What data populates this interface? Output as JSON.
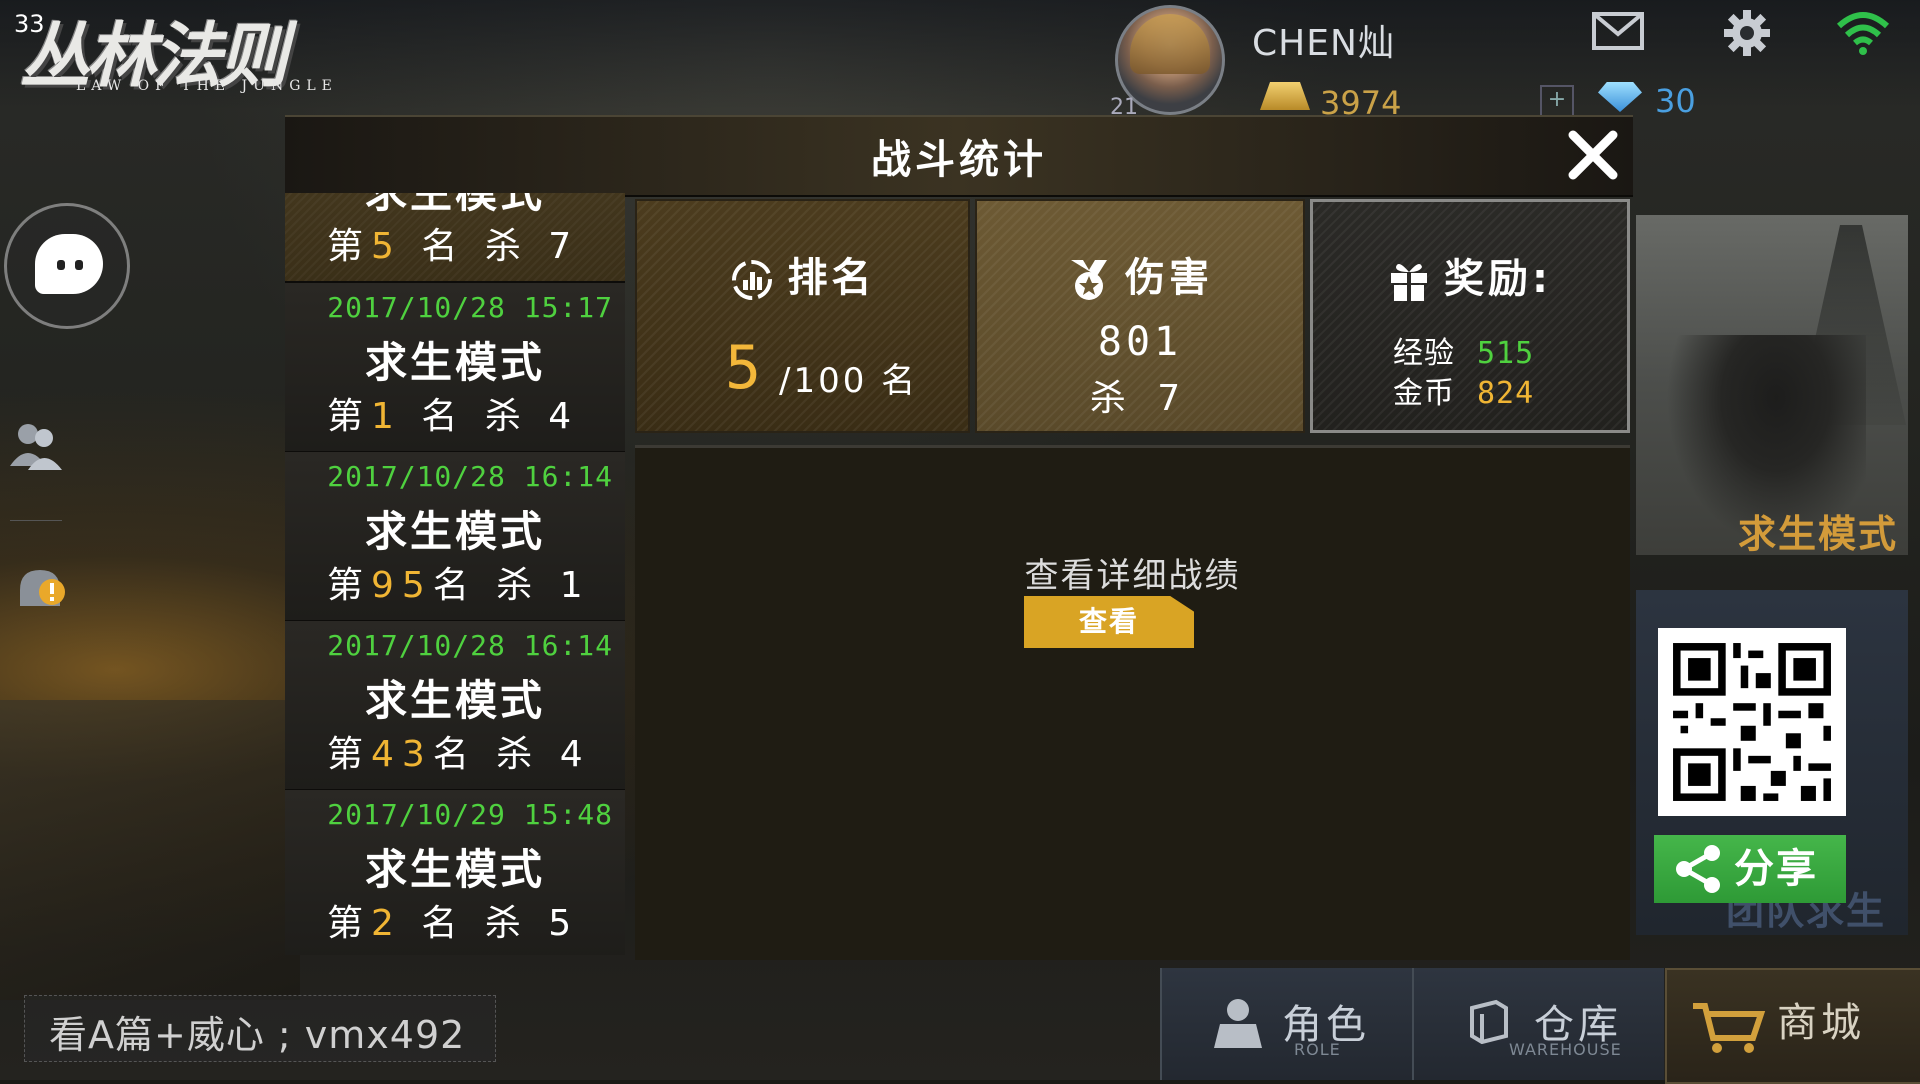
{
  "status": {
    "fps": "33"
  },
  "logo": {
    "title": "丛林法则",
    "subtitle": "LAW OF THE JUNGLE"
  },
  "profile": {
    "username": "CHEN灿",
    "level": "21",
    "gold": "3974",
    "diamonds": "30"
  },
  "dialog": {
    "title": "战斗统计",
    "close_icon": "close-icon",
    "history": [
      {
        "date": "",
        "mode": "求生模式",
        "rank_prefix": "第",
        "rank": "5",
        "rank_suffix": "名 杀",
        "kills": "7",
        "selected": true
      },
      {
        "date": "2017/10/28 15:17",
        "mode": "求生模式",
        "rank_prefix": "第",
        "rank": "1",
        "rank_suffix": "名 杀",
        "kills": "4"
      },
      {
        "date": "2017/10/28 16:14",
        "mode": "求生模式",
        "rank_prefix": "第",
        "rank": "95",
        "rank_suffix": "名 杀",
        "kills": "1"
      },
      {
        "date": "2017/10/28 16:14",
        "mode": "求生模式",
        "rank_prefix": "第",
        "rank": "43",
        "rank_suffix": "名 杀",
        "kills": "4"
      },
      {
        "date": "2017/10/29 15:48",
        "mode": "求生模式",
        "rank_prefix": "第",
        "rank": "2",
        "rank_suffix": "名 杀",
        "kills": "5"
      }
    ],
    "rank_card": {
      "title": "排名",
      "value": "5",
      "total": "/100 名"
    },
    "damage_card": {
      "title": "伤害",
      "value": "801",
      "kills_label": "杀",
      "kills": "7"
    },
    "reward_card": {
      "title": "奖励:",
      "exp_label": "经验",
      "exp": "515",
      "gold_label": "金币",
      "gold": "824"
    },
    "detail_label": "查看详细战绩",
    "view_button": "查看"
  },
  "right_panel": {
    "mode_label": "求生模式",
    "team_label": "团队求生",
    "share_button": "分享"
  },
  "bottom_nav": [
    {
      "label": "角色",
      "sub": "ROLE"
    },
    {
      "label": "仓库",
      "sub": "WAREHOUSE"
    },
    {
      "label": "商城",
      "sub": ""
    }
  ],
  "ad_text": "看A篇+威心 ; vmx492",
  "colors": {
    "accent_gold": "#f0b534",
    "green": "#4fd13f",
    "share_green": "#3aa840",
    "button_gold": "#d9a424"
  }
}
